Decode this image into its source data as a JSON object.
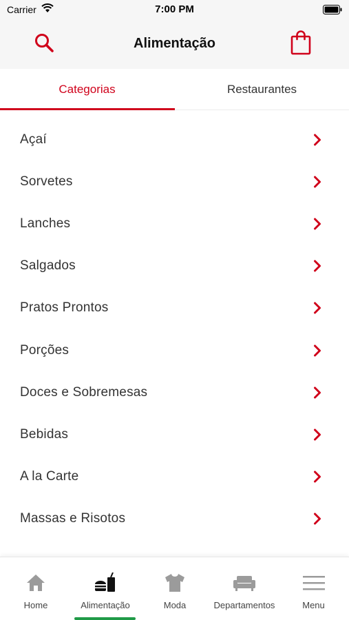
{
  "status_bar": {
    "carrier": "Carrier",
    "time": "7:00 PM"
  },
  "header": {
    "title": "Alimentação",
    "search_icon": "search-icon",
    "bag_icon": "shopping-bag-icon"
  },
  "colors": {
    "accent": "#d0021b",
    "nav_active": "#1f9a47",
    "icon_gray": "#9b9b9b"
  },
  "tabs": [
    {
      "label": "Categorias",
      "active": true
    },
    {
      "label": "Restaurantes",
      "active": false
    }
  ],
  "categories": [
    {
      "label": "Açaí"
    },
    {
      "label": "Sorvetes"
    },
    {
      "label": "Lanches"
    },
    {
      "label": "Salgados"
    },
    {
      "label": "Pratos Prontos"
    },
    {
      "label": "Porções"
    },
    {
      "label": "Doces e Sobremesas"
    },
    {
      "label": "Bebidas"
    },
    {
      "label": "A la Carte"
    },
    {
      "label": "Massas e Risotos"
    }
  ],
  "bottom_nav": [
    {
      "label": "Home",
      "icon": "home-icon",
      "active": false
    },
    {
      "label": "Alimentação",
      "icon": "food-icon",
      "active": true
    },
    {
      "label": "Moda",
      "icon": "shirt-icon",
      "active": false
    },
    {
      "label": "Departamentos",
      "icon": "sofa-icon",
      "active": false
    },
    {
      "label": "Menu",
      "icon": "menu-icon",
      "active": false
    }
  ]
}
